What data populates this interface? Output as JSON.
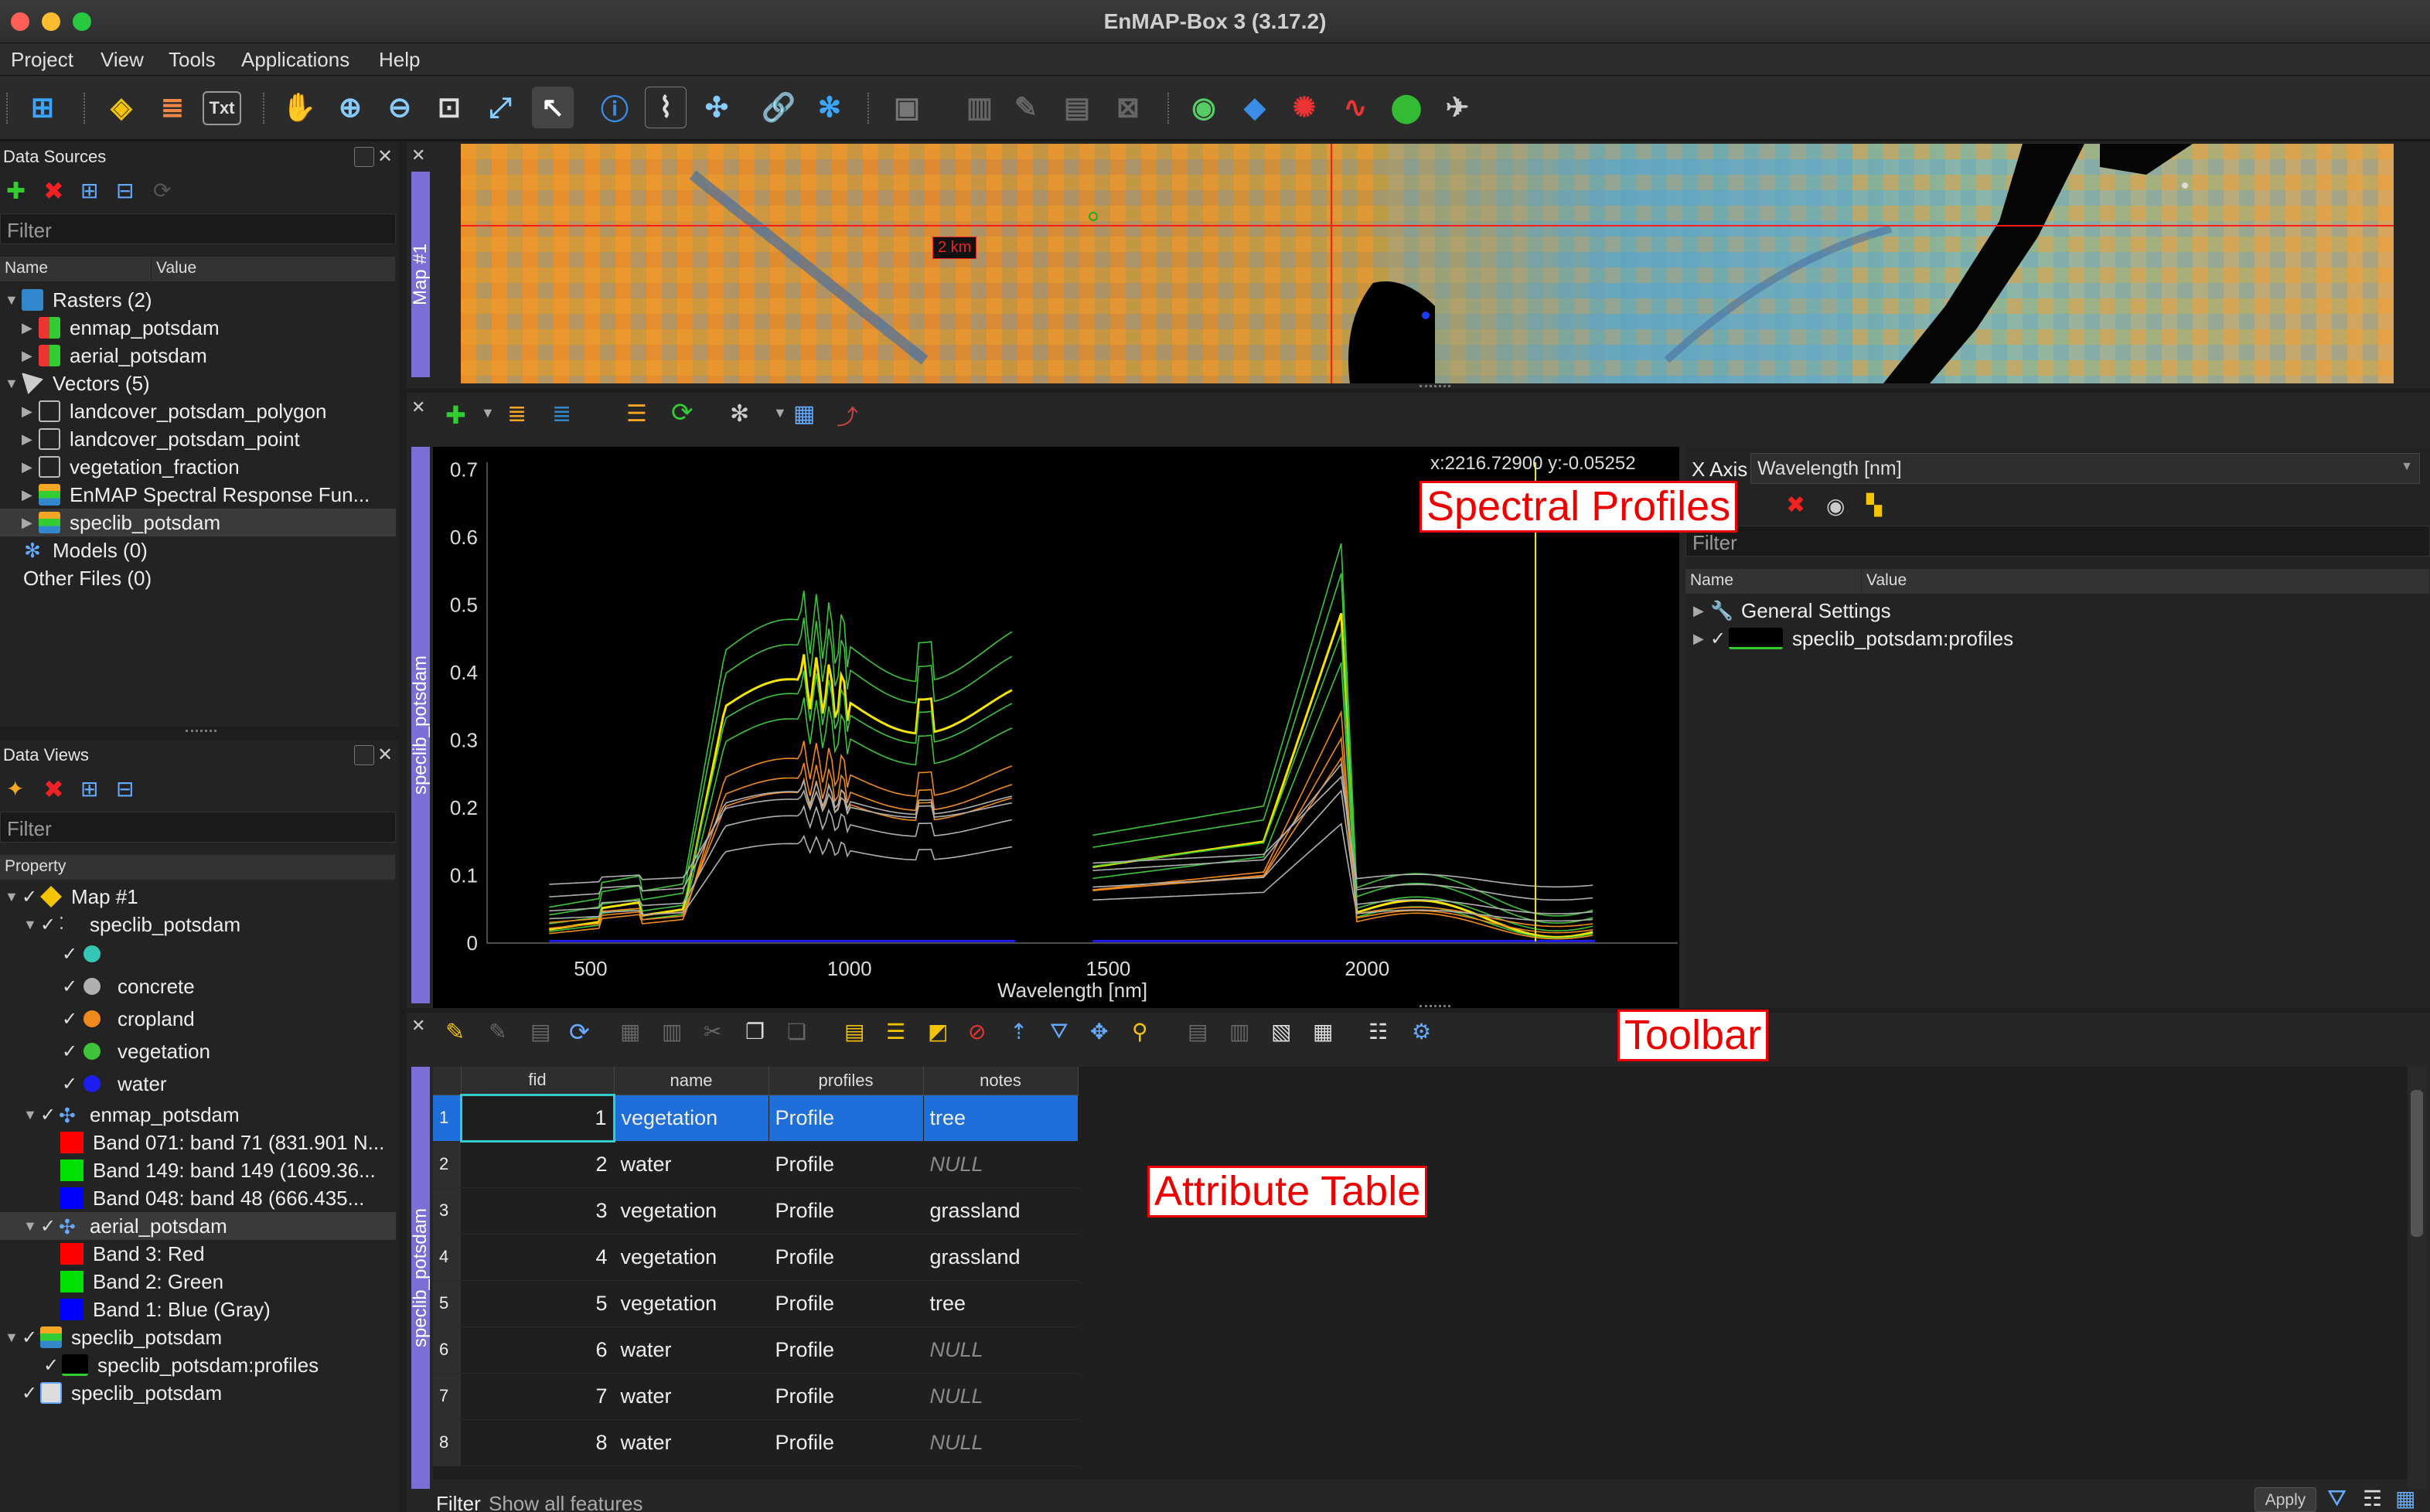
{
  "window": {
    "title": "EnMAP-Box 3 (3.17.2)"
  },
  "menu": [
    "Project",
    "View",
    "Tools",
    "Applications",
    "Help"
  ],
  "toolbar": {
    "txt_label": "Txt"
  },
  "data_sources": {
    "title": "Data Sources",
    "filter_placeholder": "Filter",
    "col_name": "Name",
    "col_value": "Value",
    "rasters": "Rasters (2)",
    "raster_items": [
      "enmap_potsdam",
      "aerial_potsdam"
    ],
    "vectors": "Vectors (5)",
    "vector_items": [
      "landcover_potsdam_polygon",
      "landcover_potsdam_point",
      "vegetation_fraction",
      "EnMAP Spectral Response Fun...",
      "speclib_potsdam"
    ],
    "models": "Models (0)",
    "other": "Other Files (0)"
  },
  "data_views": {
    "title": "Data Views",
    "filter_placeholder": "Filter",
    "col_property": "Property",
    "map": "Map #1",
    "speclib": "speclib_potsdam",
    "classes": [
      {
        "label": "",
        "color": "#35c7b5"
      },
      {
        "label": "concrete",
        "color": "#b0b0b0"
      },
      {
        "label": "cropland",
        "color": "#f08a1c"
      },
      {
        "label": "vegetation",
        "color": "#3cc43c"
      },
      {
        "label": "water",
        "color": "#1d1df0"
      }
    ],
    "enmap": "enmap_potsdam",
    "enmap_bands": [
      {
        "label": "Band 071: band 71 (831.901 N...",
        "color": "#ff0000"
      },
      {
        "label": "Band 149: band 149 (1609.36...",
        "color": "#00e000"
      },
      {
        "label": "Band 048: band 48 (666.435...",
        "color": "#0000ff"
      }
    ],
    "aerial": "aerial_potsdam",
    "aerial_bands": [
      {
        "label": "Band 3: Red",
        "color": "#ff0000"
      },
      {
        "label": "Band 2: Green",
        "color": "#00e000"
      },
      {
        "label": "Band 1: Blue (Gray)",
        "color": "#0000ff"
      }
    ],
    "speclib2": "speclib_potsdam",
    "profiles": "speclib_potsdam:profiles",
    "speclib3": "speclib_potsdam"
  },
  "map_view": {
    "label": "Map #1",
    "scale_label": "2 km"
  },
  "spectral": {
    "side_label": "speclib_potsdam",
    "coords": "x:2216.72900 y:-0.05252",
    "xaxis_label": "X Axis",
    "xaxis_value": "Wavelength [nm]",
    "filter_placeholder": "Filter",
    "col_name": "Name",
    "col_value": "Value",
    "general": "General Settings",
    "profiles": "speclib_potsdam:profiles",
    "y_ticks": [
      "0.7",
      "0.6",
      "0.5",
      "0.4",
      "0.3",
      "0.2",
      "0.1",
      "0"
    ],
    "x_ticks": [
      "500",
      "1000",
      "1500",
      "2000"
    ],
    "xlabel": "Wavelength [nm]"
  },
  "attribute_table": {
    "side_label": "speclib_potsdam",
    "columns": [
      "fid",
      "name",
      "profiles",
      "notes"
    ],
    "rows": [
      {
        "no": "1",
        "fid": "1",
        "name": "vegetation",
        "profiles": "Profile",
        "notes": "tree"
      },
      {
        "no": "2",
        "fid": "2",
        "name": "water",
        "profiles": "Profile",
        "notes": "NULL"
      },
      {
        "no": "3",
        "fid": "3",
        "name": "vegetation",
        "profiles": "Profile",
        "notes": "grassland"
      },
      {
        "no": "4",
        "fid": "4",
        "name": "vegetation",
        "profiles": "Profile",
        "notes": "grassland"
      },
      {
        "no": "5",
        "fid": "5",
        "name": "vegetation",
        "profiles": "Profile",
        "notes": "tree"
      },
      {
        "no": "6",
        "fid": "6",
        "name": "water",
        "profiles": "Profile",
        "notes": "NULL"
      },
      {
        "no": "7",
        "fid": "7",
        "name": "water",
        "profiles": "Profile",
        "notes": "NULL"
      },
      {
        "no": "8",
        "fid": "8",
        "name": "water",
        "profiles": "Profile",
        "notes": "NULL"
      }
    ],
    "filter_label": "Filter",
    "filter_value": "Show all features",
    "apply": "Apply"
  },
  "callouts": {
    "spectral": "Spectral Profiles",
    "toolbar": "Toolbar",
    "attribute": "Attribute Table"
  }
}
